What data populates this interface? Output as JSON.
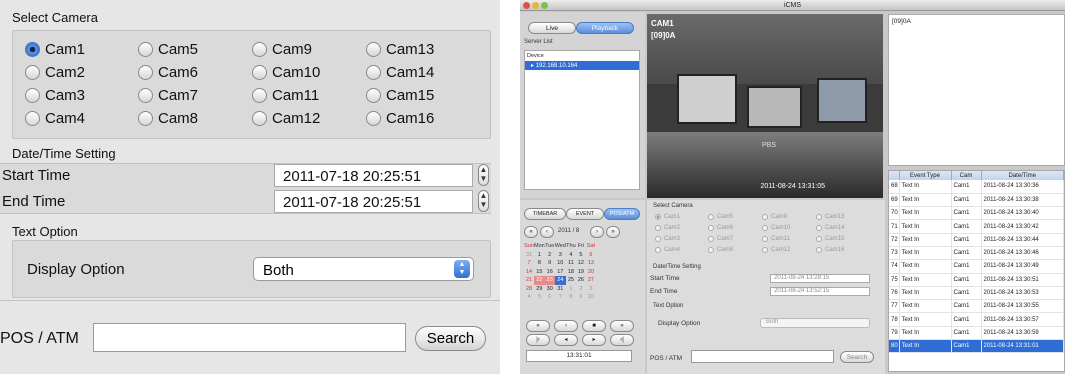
{
  "zoom": {
    "select_camera": "Select Camera",
    "cameras": [
      "Cam1",
      "Cam2",
      "Cam3",
      "Cam4",
      "Cam5",
      "Cam6",
      "Cam7",
      "Cam8",
      "Cam9",
      "Cam10",
      "Cam11",
      "Cam12",
      "Cam13",
      "Cam14",
      "Cam15",
      "Cam16"
    ],
    "selected_camera": "Cam1",
    "datetime_setting": "Date/Time Setting",
    "start_time_label": "Start Time",
    "start_time": "2011-07-18 20:25:51",
    "end_time_label": "End Time",
    "end_time": "2011-07-18 20:25:51",
    "text_option": "Text Option",
    "display_option_label": "Display Option",
    "display_option": "Both",
    "pos_atm_label": "POS / ATM",
    "pos_atm_value": "",
    "search": "Search"
  },
  "app": {
    "title": "iCMS",
    "tab_live": "Live",
    "tab_playback": "Playback",
    "server_list": "Server List",
    "device_header": "Device",
    "device": "192.168.10.164",
    "video_cam": "CAM1",
    "video_sub": "[09]0A",
    "video_time": "2011-08-24 13:31:05",
    "info_title": "[09]0A",
    "tabs": [
      "TIMEBAR",
      "EVENT",
      "POS/ATM"
    ],
    "cal_month": "2011 / 8",
    "cal_days": [
      "Sun",
      "Mon",
      "Tue",
      "Wed",
      "Thu",
      "Fri",
      "Sat"
    ],
    "cal_weeks": [
      [
        "31",
        "1",
        "2",
        "3",
        "4",
        "5",
        "6"
      ],
      [
        "7",
        "8",
        "9",
        "10",
        "11",
        "12",
        "13"
      ],
      [
        "14",
        "15",
        "16",
        "17",
        "18",
        "19",
        "20"
      ],
      [
        "21",
        "22",
        "23",
        "24",
        "25",
        "26",
        "27"
      ],
      [
        "28",
        "29",
        "30",
        "31",
        "1",
        "2",
        "3"
      ],
      [
        "4",
        "5",
        "6",
        "7",
        "8",
        "9",
        "10"
      ]
    ],
    "clock": "13:31:01",
    "select_camera": "Select Camera",
    "cameras": [
      "Cam1",
      "Cam2",
      "Cam3",
      "Cam4",
      "Cam5",
      "Cam6",
      "Cam7",
      "Cam8",
      "Cam9",
      "Cam10",
      "Cam11",
      "Cam12",
      "Cam13",
      "Cam14",
      "Cam15",
      "Cam16"
    ],
    "datetime_setting": "Date/Time Setting",
    "start_time_label": "Start Time",
    "start_time": "2011-08-24 13:28:15",
    "end_time_label": "End Time",
    "end_time": "2011-08-24 13:52:15",
    "text_option": "Text Option",
    "display_option_label": "Display Option",
    "display_option": "Both",
    "pos_atm_label": "POS / ATM",
    "search": "Search",
    "event_columns": [
      "",
      "Event Type",
      "Cam",
      "Date/Time"
    ],
    "events": [
      [
        "68",
        "Text In",
        "Cam1",
        "2011-08-24 13:30:36"
      ],
      [
        "69",
        "Text In",
        "Cam1",
        "2011-08-24 13:30:38"
      ],
      [
        "70",
        "Text In",
        "Cam1",
        "2011-08-24 13:30:40"
      ],
      [
        "71",
        "Text In",
        "Cam1",
        "2011-08-24 13:30:42"
      ],
      [
        "72",
        "Text In",
        "Cam1",
        "2011-08-24 13:30:44"
      ],
      [
        "73",
        "Text In",
        "Cam1",
        "2011-08-24 13:30:46"
      ],
      [
        "74",
        "Text In",
        "Cam1",
        "2011-08-24 13:30:49"
      ],
      [
        "75",
        "Text In",
        "Cam1",
        "2011-08-24 13:30:51"
      ],
      [
        "76",
        "Text In",
        "Cam1",
        "2011-08-24 13:30:53"
      ],
      [
        "77",
        "Text In",
        "Cam1",
        "2011-08-24 13:30:55"
      ],
      [
        "78",
        "Text In",
        "Cam1",
        "2011-08-24 13:30:57"
      ],
      [
        "79",
        "Text In",
        "Cam1",
        "2011-08-24 13:30:59"
      ],
      [
        "80",
        "Text In",
        "Cam1",
        "2011-08-24 13:31:01"
      ]
    ],
    "selected_event": "80"
  }
}
